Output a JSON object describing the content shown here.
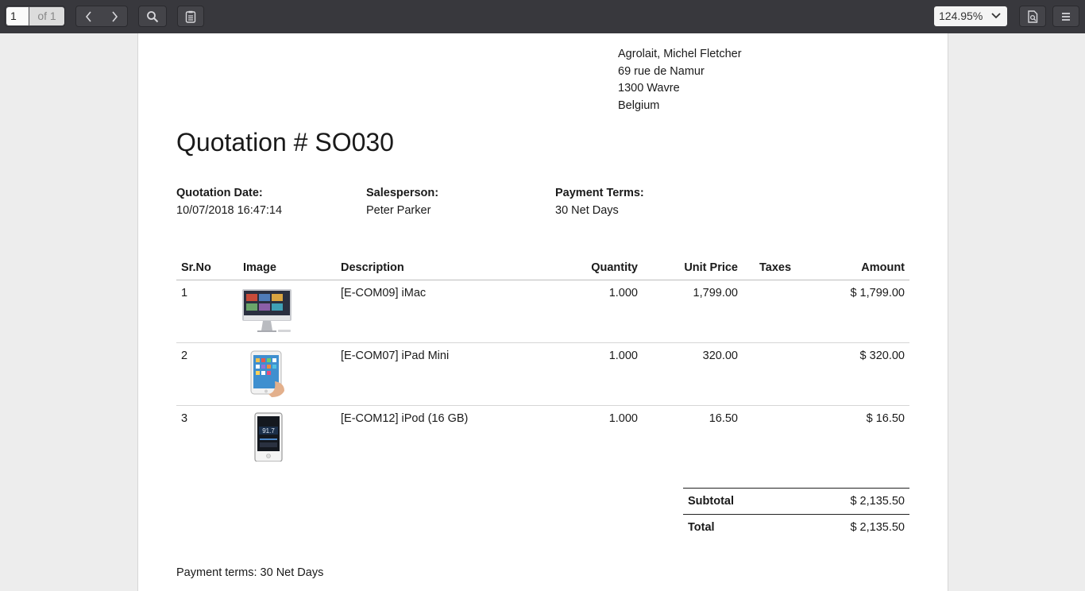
{
  "toolbar": {
    "page_number": "1",
    "page_of": "of 1",
    "zoom": "124.95%",
    "icons": [
      "chevron-left-icon",
      "chevron-right-icon",
      "search-icon",
      "sidebar-toggle-icon",
      "chevron-down-icon",
      "document-properties-icon",
      "menu-icon"
    ]
  },
  "document": {
    "address": {
      "line1": "Agrolait, Michel Fletcher",
      "line2": "69 rue de Namur",
      "line3": "1300 Wavre",
      "line4": "Belgium"
    },
    "title": "Quotation # SO030",
    "info": {
      "date_label": "Quotation Date:",
      "date_value": "10/07/2018 16:47:14",
      "salesperson_label": "Salesperson:",
      "salesperson_value": "Peter Parker",
      "terms_label": "Payment Terms:",
      "terms_value": "30 Net Days"
    },
    "table": {
      "headers": {
        "srno": "Sr.No",
        "image": "Image",
        "description": "Description",
        "quantity": "Quantity",
        "unit_price": "Unit Price",
        "taxes": "Taxes",
        "amount": "Amount"
      },
      "rows": [
        {
          "srno": "1",
          "image": "imac",
          "description": "[E-COM09] iMac",
          "quantity": "1.000",
          "unit_price": "1,799.00",
          "taxes": "",
          "amount": "$ 1,799.00"
        },
        {
          "srno": "2",
          "image": "ipad-mini",
          "description": "[E-COM07] iPad Mini",
          "quantity": "1.000",
          "unit_price": "320.00",
          "taxes": "",
          "amount": "$ 320.00"
        },
        {
          "srno": "3",
          "image": "ipod",
          "description": "[E-COM12] iPod (16 GB)",
          "quantity": "1.000",
          "unit_price": "16.50",
          "taxes": "",
          "amount": "$ 16.50"
        }
      ]
    },
    "totals": {
      "subtotal_label": "Subtotal",
      "subtotal_value": "$ 2,135.50",
      "total_label": "Total",
      "total_value": "$ 2,135.50"
    },
    "payment_note": "Payment terms: 30 Net Days"
  }
}
